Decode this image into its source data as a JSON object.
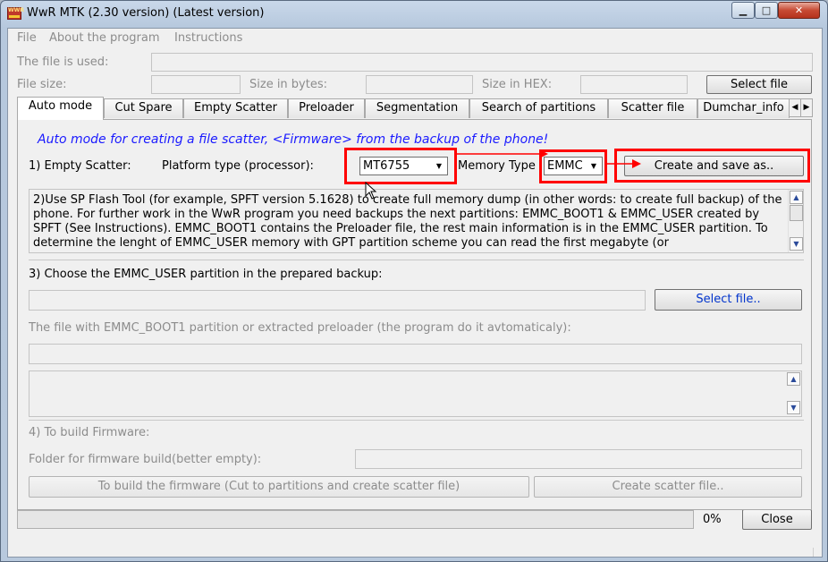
{
  "window": {
    "title": "WwR MTK (2.30 version) (Latest version)",
    "icon_name": "wwr-app-icon",
    "icon_text": "WWR"
  },
  "menu": [
    "File",
    "About the program",
    "Instructions"
  ],
  "file_info": {
    "file_used_label": "The file is used:",
    "file_used_value": "",
    "file_size_label": "File size:",
    "file_size_value": "",
    "size_bytes_label": "Size in bytes:",
    "size_bytes_value": "",
    "size_hex_label": "Size in HEX:",
    "size_hex_value": "",
    "select_file_button": "Select file"
  },
  "tabs": [
    "Auto mode",
    "Cut Spare",
    "Empty Scatter",
    "Preloader",
    "Segmentation",
    "Search of partitions",
    "Scatter file",
    "Dumchar_info"
  ],
  "active_tab": "Auto mode",
  "auto_mode": {
    "heading": "Auto mode for creating a file scatter, <Firmware> from the backup of the phone!",
    "step1_label": "1) Empty Scatter:",
    "platform_label": "Platform type (processor):",
    "platform_value": "MT6755",
    "memory_label": "Memory Type",
    "memory_value": "EMMC",
    "create_save_button": "Create and save as..",
    "step2_text": "2)Use SP Flash Tool (for example, SPFT version 5.1628) to create full memory dump (in other words: to create full backup) of the phone. For further work in the WwR program you need backups the next partitions: EMMC_BOOT1 & EMMC_USER created by SPFT (See Instructions). EMMC_BOOT1 contains the Preloader file, the rest main information is in the EMMC_USER partition. To determine the lenght of EMMC_USER memory with GPT partition scheme you can read the first megabyte (or",
    "step3_label": "3) Choose the EMMC_USER partition in the prepared backup:",
    "emmc_user_value": "",
    "select_file_button": "Select file..",
    "boot1_label": "The file with EMMC_BOOT1 partition or extracted preloader (the program do it avtomaticaly):",
    "boot1_value": "",
    "log_text": "",
    "step4_label": "4) To build Firmware:",
    "folder_label": "Folder for firmware build(better empty):",
    "folder_value": "",
    "build_button": "To build the firmware (Cut to partitions and create scatter file)",
    "create_scatter_button": "Create scatter file.."
  },
  "footer": {
    "progress": 0,
    "progress_text": "0%",
    "close_button": "Close"
  },
  "colors": {
    "heading_blue": "#1a1aff",
    "highlight_red": "#ff0000",
    "link_blue": "#0033cc"
  }
}
